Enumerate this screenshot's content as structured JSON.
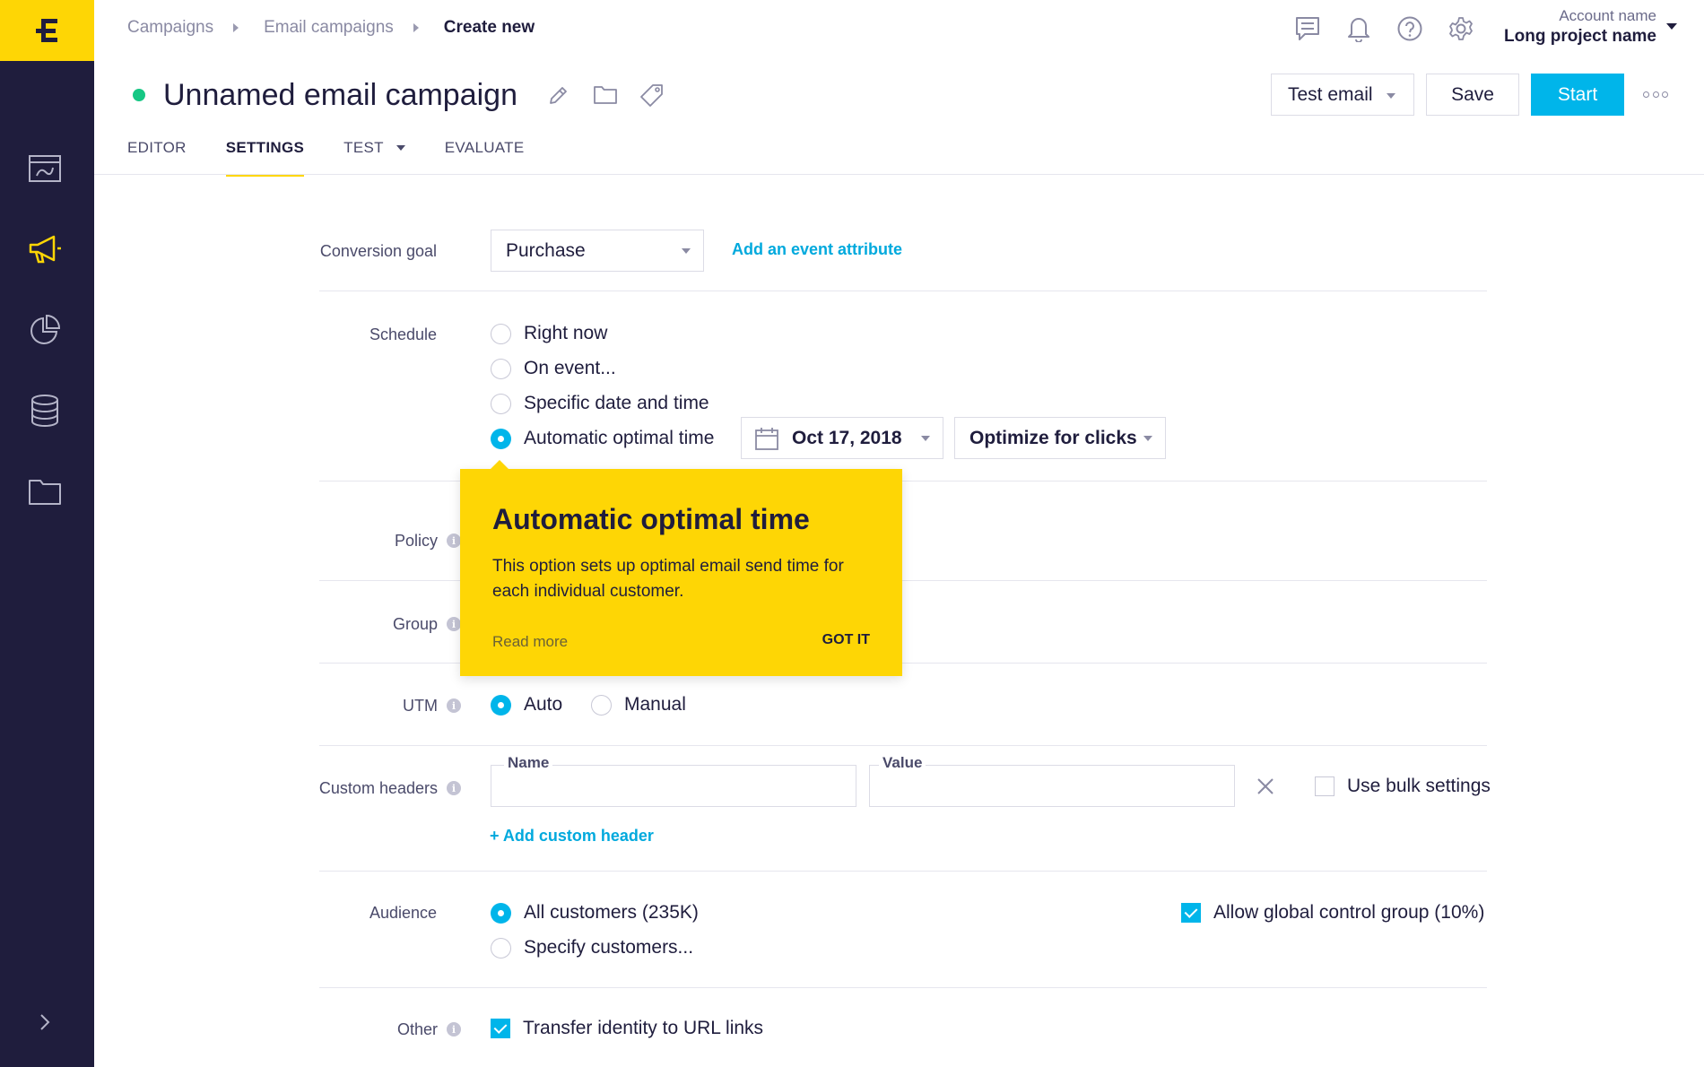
{
  "brand": {
    "accent": "#fed605",
    "sidebar_bg": "#1f1d3d",
    "primary": "#00b5ea",
    "status": "#16c784"
  },
  "sidebar": {
    "logo_icon": "exponea-logo",
    "items": [
      {
        "icon": "dashboard-icon"
      },
      {
        "icon": "megaphone-icon",
        "active": true
      },
      {
        "icon": "pie-chart-icon"
      },
      {
        "icon": "database-icon"
      },
      {
        "icon": "folder-icon"
      }
    ],
    "expand_icon": "chevron-right-icon"
  },
  "breadcrumb": [
    "Campaigns",
    "Email campaigns",
    "Create new"
  ],
  "account": {
    "name": "Account name",
    "project": "Long project name"
  },
  "title": "Unnamed email campaign",
  "actions": {
    "test": "Test email",
    "save": "Save",
    "start": "Start"
  },
  "tabs": [
    "EDITOR",
    "SETTINGS",
    "TEST",
    "EVALUATE"
  ],
  "form": {
    "conversion_goal": {
      "label": "Conversion goal",
      "value": "Purchase",
      "link": "Add an event attribute"
    },
    "schedule": {
      "label": "Schedule",
      "options": [
        "Right now",
        "On event...",
        "Specific date and time",
        "Automatic optimal time"
      ],
      "selected": "Automatic optimal time",
      "date": "Oct 17, 2018",
      "optimize": "Optimize for clicks"
    },
    "policy": {
      "label": "Policy"
    },
    "group": {
      "label": "Group"
    },
    "utm": {
      "label": "UTM",
      "options": [
        "Auto",
        "Manual"
      ],
      "selected": "Auto"
    },
    "custom_headers": {
      "label": "Custom headers",
      "name_label": "Name",
      "value_label": "Value",
      "bulk": "Use bulk settings",
      "add": "+ Add custom header"
    },
    "audience": {
      "label": "Audience",
      "options": [
        "All customers (235K)",
        "Specify customers..."
      ],
      "selected": "All customers (235K)",
      "control_group": "Allow global control group (10%)"
    },
    "other": {
      "label": "Other",
      "transfer": "Transfer identity to URL links"
    }
  },
  "tooltip": {
    "title": "Automatic optimal time",
    "body": "This option sets up optimal email send time for each individual customer.",
    "read_more": "Read more",
    "got_it": "GOT IT"
  }
}
